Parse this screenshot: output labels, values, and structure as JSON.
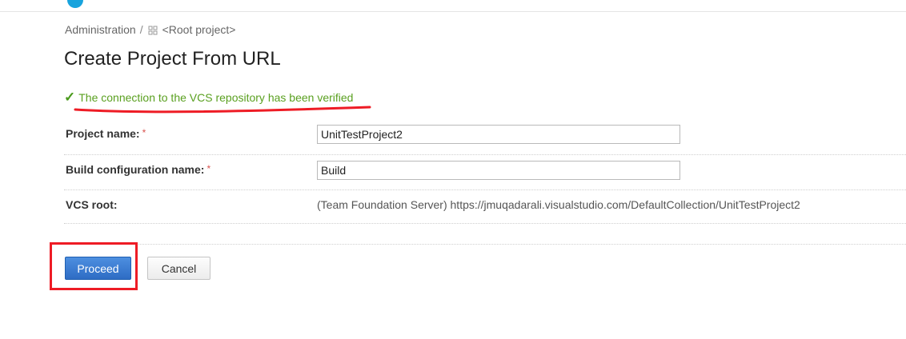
{
  "breadcrumb": {
    "root": "Administration",
    "separator": "/",
    "project": "<Root project>",
    "project_icon": "grid-icon"
  },
  "page": {
    "title": "Create Project From URL"
  },
  "status": {
    "check_glyph": "✓",
    "message": "The connection to the VCS repository has been verified",
    "color": "#5aa020"
  },
  "form": {
    "project_name": {
      "label": "Project name:",
      "required_mark": "*",
      "value": "UnitTestProject2"
    },
    "build_config_name": {
      "label": "Build configuration name:",
      "required_mark": "*",
      "value": "Build"
    },
    "vcs_root": {
      "label": "VCS root:",
      "value": "(Team Foundation Server) https://jmuqadarali.visualstudio.com/DefaultCollection/UnitTestProject2"
    }
  },
  "buttons": {
    "proceed": "Proceed",
    "cancel": "Cancel"
  },
  "annotations": {
    "highlight_color": "#ee1c25"
  }
}
